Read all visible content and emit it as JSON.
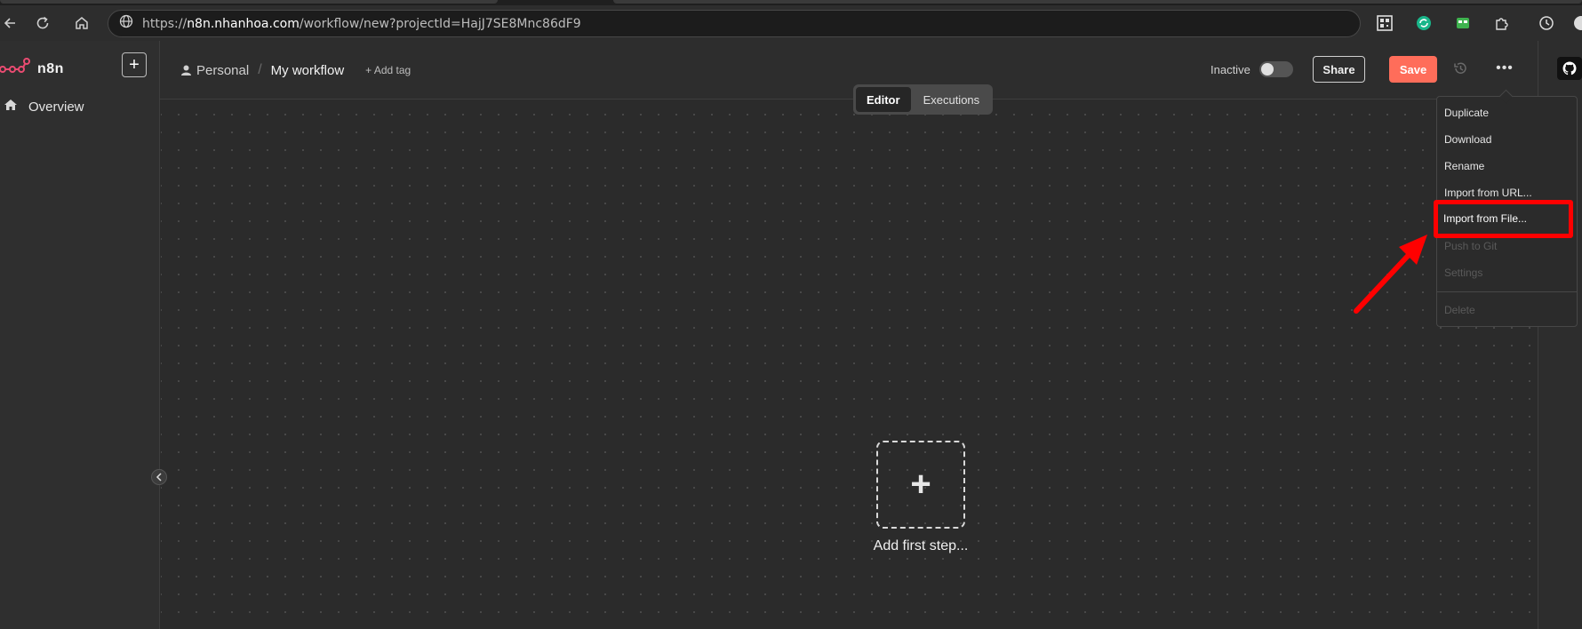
{
  "browser": {
    "url_prefix": "https://",
    "url_host": "n8n.nhanhoa.com",
    "url_path": "/workflow/new?projectId=HajJ7SE8Mnc86dF9"
  },
  "sidebar": {
    "logo_text": "n8n",
    "add_label": "+",
    "overview_label": "Overview"
  },
  "header": {
    "project": "Personal",
    "separator": "/",
    "workflow_name": "My workflow",
    "add_tag": "+ Add tag",
    "status": "Inactive",
    "share": "Share",
    "save": "Save",
    "more": "•••"
  },
  "tabs": {
    "editor": "Editor",
    "executions": "Executions"
  },
  "canvas": {
    "add_symbol": "+",
    "add_first_step": "Add first step..."
  },
  "menu": {
    "items": [
      {
        "label": "Duplicate",
        "enabled": true
      },
      {
        "label": "Download",
        "enabled": true
      },
      {
        "label": "Rename",
        "enabled": true
      },
      {
        "label": "Import from URL...",
        "enabled": true
      },
      {
        "label": "Import from File...",
        "enabled": true
      },
      {
        "label": "Push to Git",
        "enabled": false
      },
      {
        "label": "Settings",
        "enabled": false
      },
      {
        "label": "Delete",
        "enabled": false
      }
    ]
  },
  "colors": {
    "accent": "#ff6d5a",
    "annotation": "#ff0000",
    "background": "#2b2b2b"
  }
}
